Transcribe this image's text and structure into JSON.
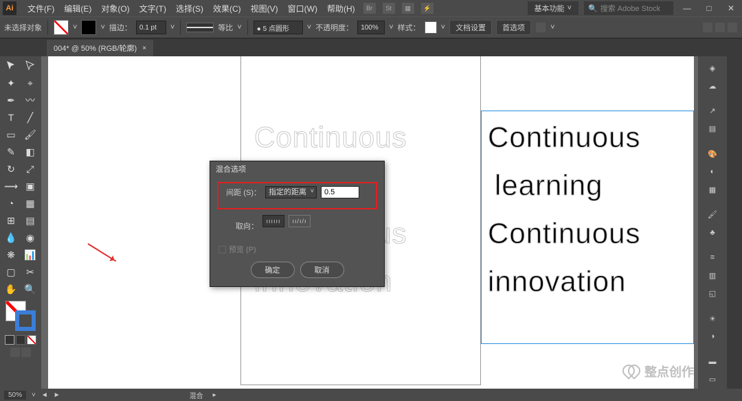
{
  "menu": {
    "file": "文件(F)",
    "edit": "编辑(E)",
    "object": "对象(O)",
    "type": "文字(T)",
    "select": "选择(S)",
    "effect": "效果(C)",
    "view": "视图(V)",
    "window": "窗口(W)",
    "help": "帮助(H)"
  },
  "workspace": "基本功能",
  "search_placeholder": "搜索 Adobe Stock",
  "options": {
    "no_selection": "未选择对象",
    "stroke_label": "描边：",
    "stroke_weight": "0.1 pt",
    "uniform": "等比",
    "brush_def": "● 5 点圆形",
    "opacity_label": "不透明度：",
    "opacity": "100%",
    "style_label": "样式：",
    "doc_setup": "文档设置",
    "preferences": "首选项"
  },
  "tab": {
    "label": "004* @ 50% (RGB/轮廓)",
    "close": "×"
  },
  "canvas_text": {
    "l1": "Continuous",
    "l2": "learning",
    "l3": "Continuous",
    "l4": "innovation"
  },
  "dialog": {
    "title": "混合选项",
    "spacing_label": "间距 (S)：",
    "spacing_mode": "指定的距离",
    "spacing_value": "0.5",
    "orient_label": "取向：",
    "orient1": "ıııııı",
    "orient2": "ıı/ı/ı",
    "preview": "预览 (P)",
    "ok": "确定",
    "cancel": "取消"
  },
  "status": {
    "zoom": "50%",
    "nav": "混合"
  },
  "watermark": "整点创作"
}
